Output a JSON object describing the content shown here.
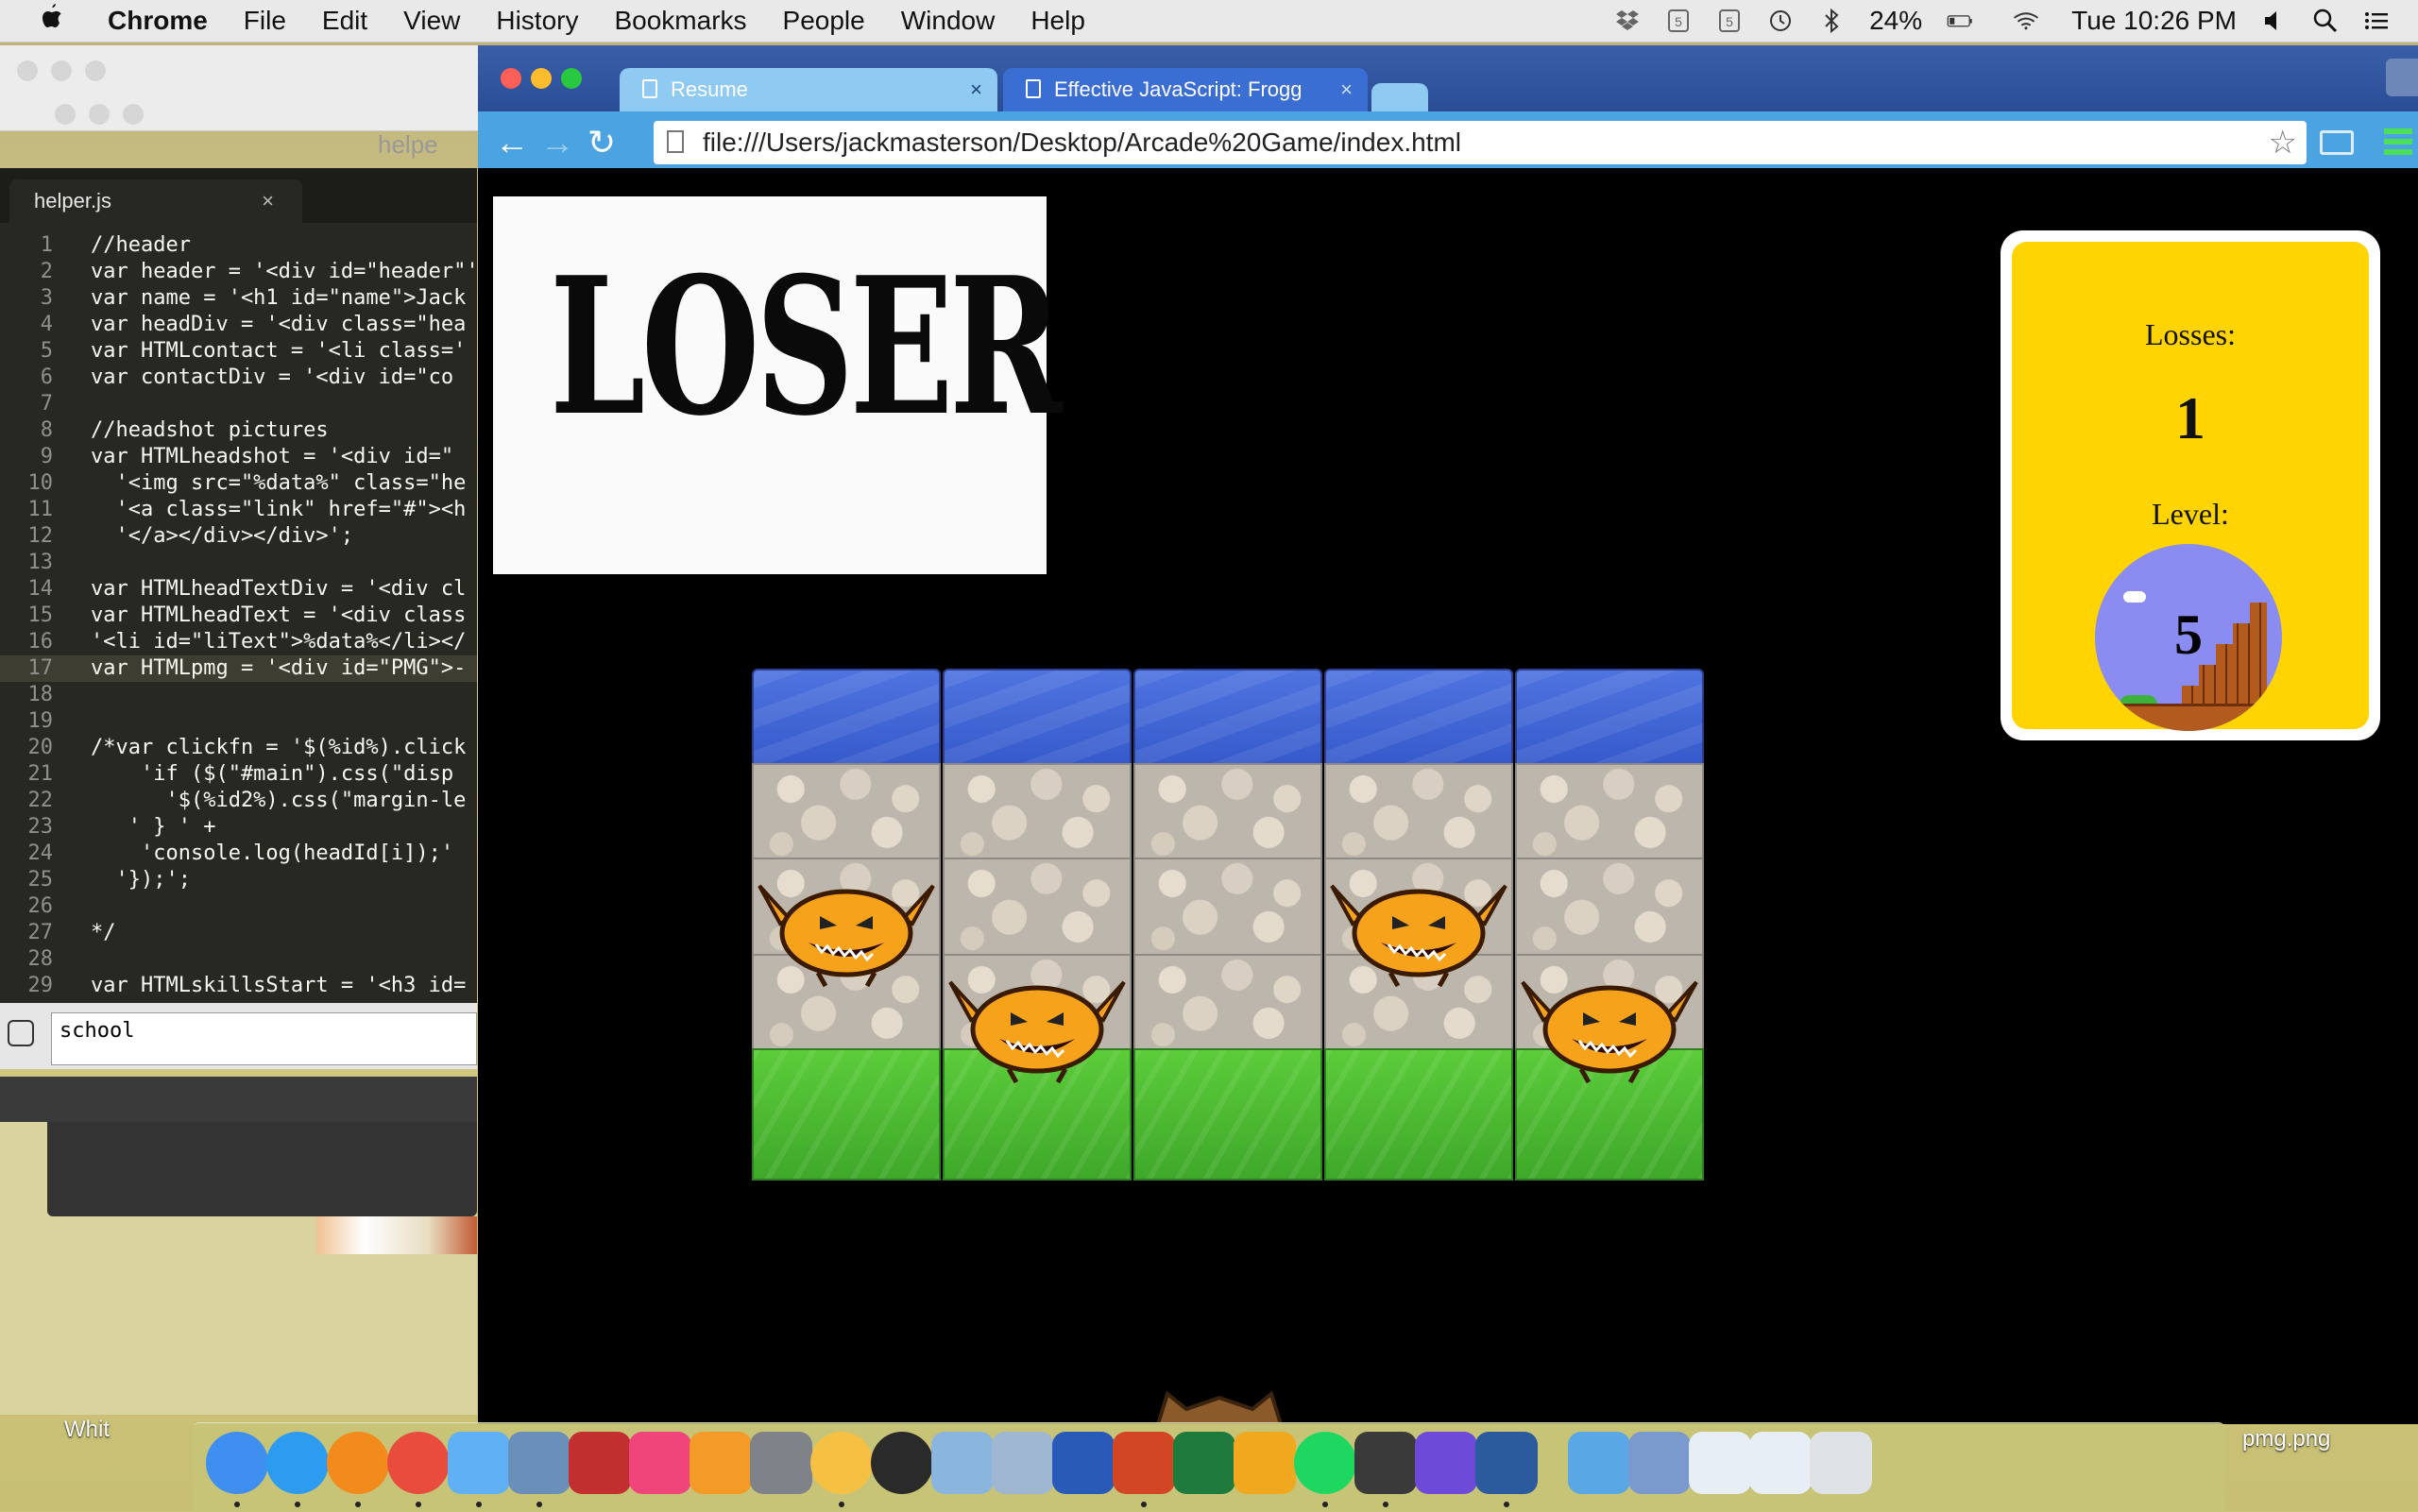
{
  "menubar": {
    "app": "Chrome",
    "items": [
      "File",
      "Edit",
      "View",
      "History",
      "Bookmarks",
      "People",
      "Window",
      "Help"
    ],
    "battery": "24%",
    "clock": "Tue 10:26 PM"
  },
  "background_window": {
    "title": "helpe"
  },
  "editor": {
    "tab": "helper.js",
    "tab_close": "×",
    "lines": [
      {
        "n": "1",
        "t": "//header"
      },
      {
        "n": "2",
        "t": "var header = '<div id=\"header\"'"
      },
      {
        "n": "3",
        "t": "var name = '<h1 id=\"name\">Jack"
      },
      {
        "n": "4",
        "t": "var headDiv = '<div class=\"hea"
      },
      {
        "n": "5",
        "t": "var HTMLcontact = '<li class='"
      },
      {
        "n": "6",
        "t": "var contactDiv = '<div id=\"co"
      },
      {
        "n": "7",
        "t": ""
      },
      {
        "n": "8",
        "t": "//headshot pictures"
      },
      {
        "n": "9",
        "t": "var HTMLheadshot = '<div id=\""
      },
      {
        "n": "10",
        "t": "  '<img src=\"%data%\" class=\"he"
      },
      {
        "n": "11",
        "t": "  '<a class=\"link\" href=\"#\"><h"
      },
      {
        "n": "12",
        "t": "  '</a></div></div>';"
      },
      {
        "n": "13",
        "t": ""
      },
      {
        "n": "14",
        "t": "var HTMLheadTextDiv = '<div cl"
      },
      {
        "n": "15",
        "t": "var HTMLheadText = '<div class"
      },
      {
        "n": "16",
        "t": "'<li id=\"liText\">%data%</li></"
      },
      {
        "n": "17",
        "t": "var HTMLpmg = '<div id=\"PMG\">-"
      },
      {
        "n": "18",
        "t": ""
      },
      {
        "n": "19",
        "t": ""
      },
      {
        "n": "20",
        "t": "/*var clickfn = '$(%id%).click"
      },
      {
        "n": "21",
        "t": "    'if ($(\"#main\").css(\"disp"
      },
      {
        "n": "22",
        "t": "      '$(%id2%).css(\"margin-le"
      },
      {
        "n": "23",
        "t": "   ' } ' +"
      },
      {
        "n": "24",
        "t": "    'console.log(headId[i]);'"
      },
      {
        "n": "25",
        "t": "  '});';"
      },
      {
        "n": "26",
        "t": ""
      },
      {
        "n": "27",
        "t": "*/"
      },
      {
        "n": "28",
        "t": ""
      },
      {
        "n": "29",
        "t": "var HTMLskillsStart = '<h3 id="
      }
    ],
    "console_input": "school",
    "whit_label": "Whit"
  },
  "chrome": {
    "tabs": [
      {
        "title": "Resume",
        "close": "×"
      },
      {
        "title": "Effective JavaScript: Frogg",
        "close": "×"
      }
    ],
    "url": "file:///Users/jackmasterson/Desktop/Arcade%20Game/index.html",
    "nav": {
      "back": "←",
      "forward": "→",
      "reload": "↻",
      "star": "☆"
    }
  },
  "game": {
    "banner": "LOSER",
    "losses_label": "Losses:",
    "losses_value": "1",
    "level_label": "Level:",
    "level_value": "5",
    "rows": [
      "water",
      "stone",
      "stone",
      "stone",
      "grass"
    ],
    "columns": 5,
    "enemies": [
      {
        "row": 2,
        "col": 0
      },
      {
        "row": 2,
        "col": 3
      },
      {
        "row": 3,
        "col": 1
      },
      {
        "row": 3,
        "col": 4
      }
    ],
    "colors": {
      "scorecard": "#ffd400",
      "water": "#4f74e0",
      "grass": "#4fbd32",
      "enemy": "#f7a21b"
    }
  },
  "dock": {
    "apps": [
      "Finder",
      "Safari",
      "Firefox",
      "Chrome",
      "Messages",
      "Preview",
      "Photo Booth",
      "iTunes",
      "iBooks",
      "System Preferences",
      "Photos",
      "Time Machine",
      "Preview Docs",
      "Image Capture",
      "Word",
      "PowerPoint",
      "Excel",
      "Outlook",
      "Spotify",
      "Sublime Text",
      "iMovie",
      "QuickTime",
      "Downloads",
      "Calendar Folder",
      "Document",
      "Document 2",
      "Trash"
    ],
    "file_label": "pmg.png"
  }
}
